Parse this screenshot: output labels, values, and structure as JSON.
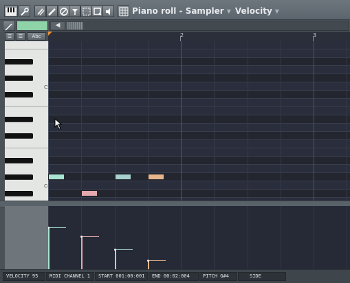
{
  "toolbar": {
    "title": "Piano roll - Sampler",
    "mode": "Velocity",
    "colors": {
      "accent": "#8fd3a8"
    }
  },
  "timeline": {
    "bars": [
      "2",
      "3"
    ]
  },
  "keyboard": {
    "octave_labels": [
      "C5",
      "C4"
    ]
  },
  "sidebar": {
    "abc_label": "Abc"
  },
  "notes": [
    {
      "bar": 1.0,
      "length": 0.125,
      "pitch": "G#4",
      "color": "#a8e4d2",
      "velocity": 0.95
    },
    {
      "bar": 1.25,
      "length": 0.125,
      "pitch": "F#4",
      "color": "#e4a9ad",
      "velocity": 0.75
    },
    {
      "bar": 1.5,
      "length": 0.125,
      "pitch": "G#4",
      "color": "#a8d2cf",
      "velocity": 0.45
    },
    {
      "bar": 1.75,
      "length": 0.125,
      "pitch": "G#4",
      "color": "#e7b58c",
      "velocity": 0.2
    }
  ],
  "status": {
    "velocity": "VELOCITY  95",
    "channel": "MIDI CHANNEL  1",
    "start": "START  001:00:001",
    "end": "END   00:02:004",
    "pitch": "PITCH  G#4",
    "side": "SIDE"
  }
}
